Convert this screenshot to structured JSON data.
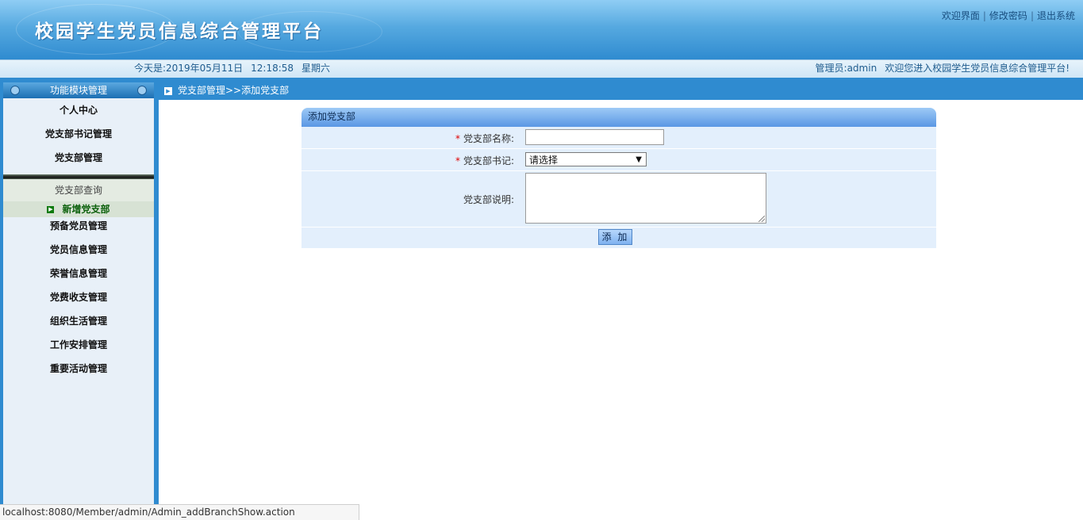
{
  "header": {
    "title": "校园学生党员信息综合管理平台",
    "links": [
      "欢迎界面",
      "修改密码",
      "退出系统"
    ],
    "separator": "|"
  },
  "info_bar": {
    "date_label": "今天是:",
    "date": "2019年05月11日",
    "time": "12:18:58",
    "weekday": "星期六",
    "admin_label": "管理员:",
    "admin_name": "admin",
    "welcome": "欢迎您进入校园学生党员信息综合管理平台!"
  },
  "sidebar": {
    "header": "功能模块管理",
    "items_top": [
      "个人中心",
      "党支部书记管理",
      "党支部管理"
    ],
    "submenu": [
      "党支部查询",
      "新增党支部"
    ],
    "items_bottom": [
      "预备党员管理",
      "党员信息管理",
      "荣誉信息管理",
      "党费收支管理",
      "组织生活管理",
      "工作安排管理",
      "重要活动管理"
    ]
  },
  "breadcrumb": "党支部管理>>添加党支部",
  "form": {
    "title": "添加党支部",
    "required_mark": "*",
    "name_label": "党支部名称:",
    "name_value": "",
    "secretary_label": "党支部书记:",
    "secretary_selected": "请选择",
    "desc_label": "党支部说明:",
    "desc_value": "",
    "submit_label": "添 加"
  },
  "status_bar": {
    "url": "localhost:8080/Member/admin/Admin_addBranchShow.action"
  }
}
